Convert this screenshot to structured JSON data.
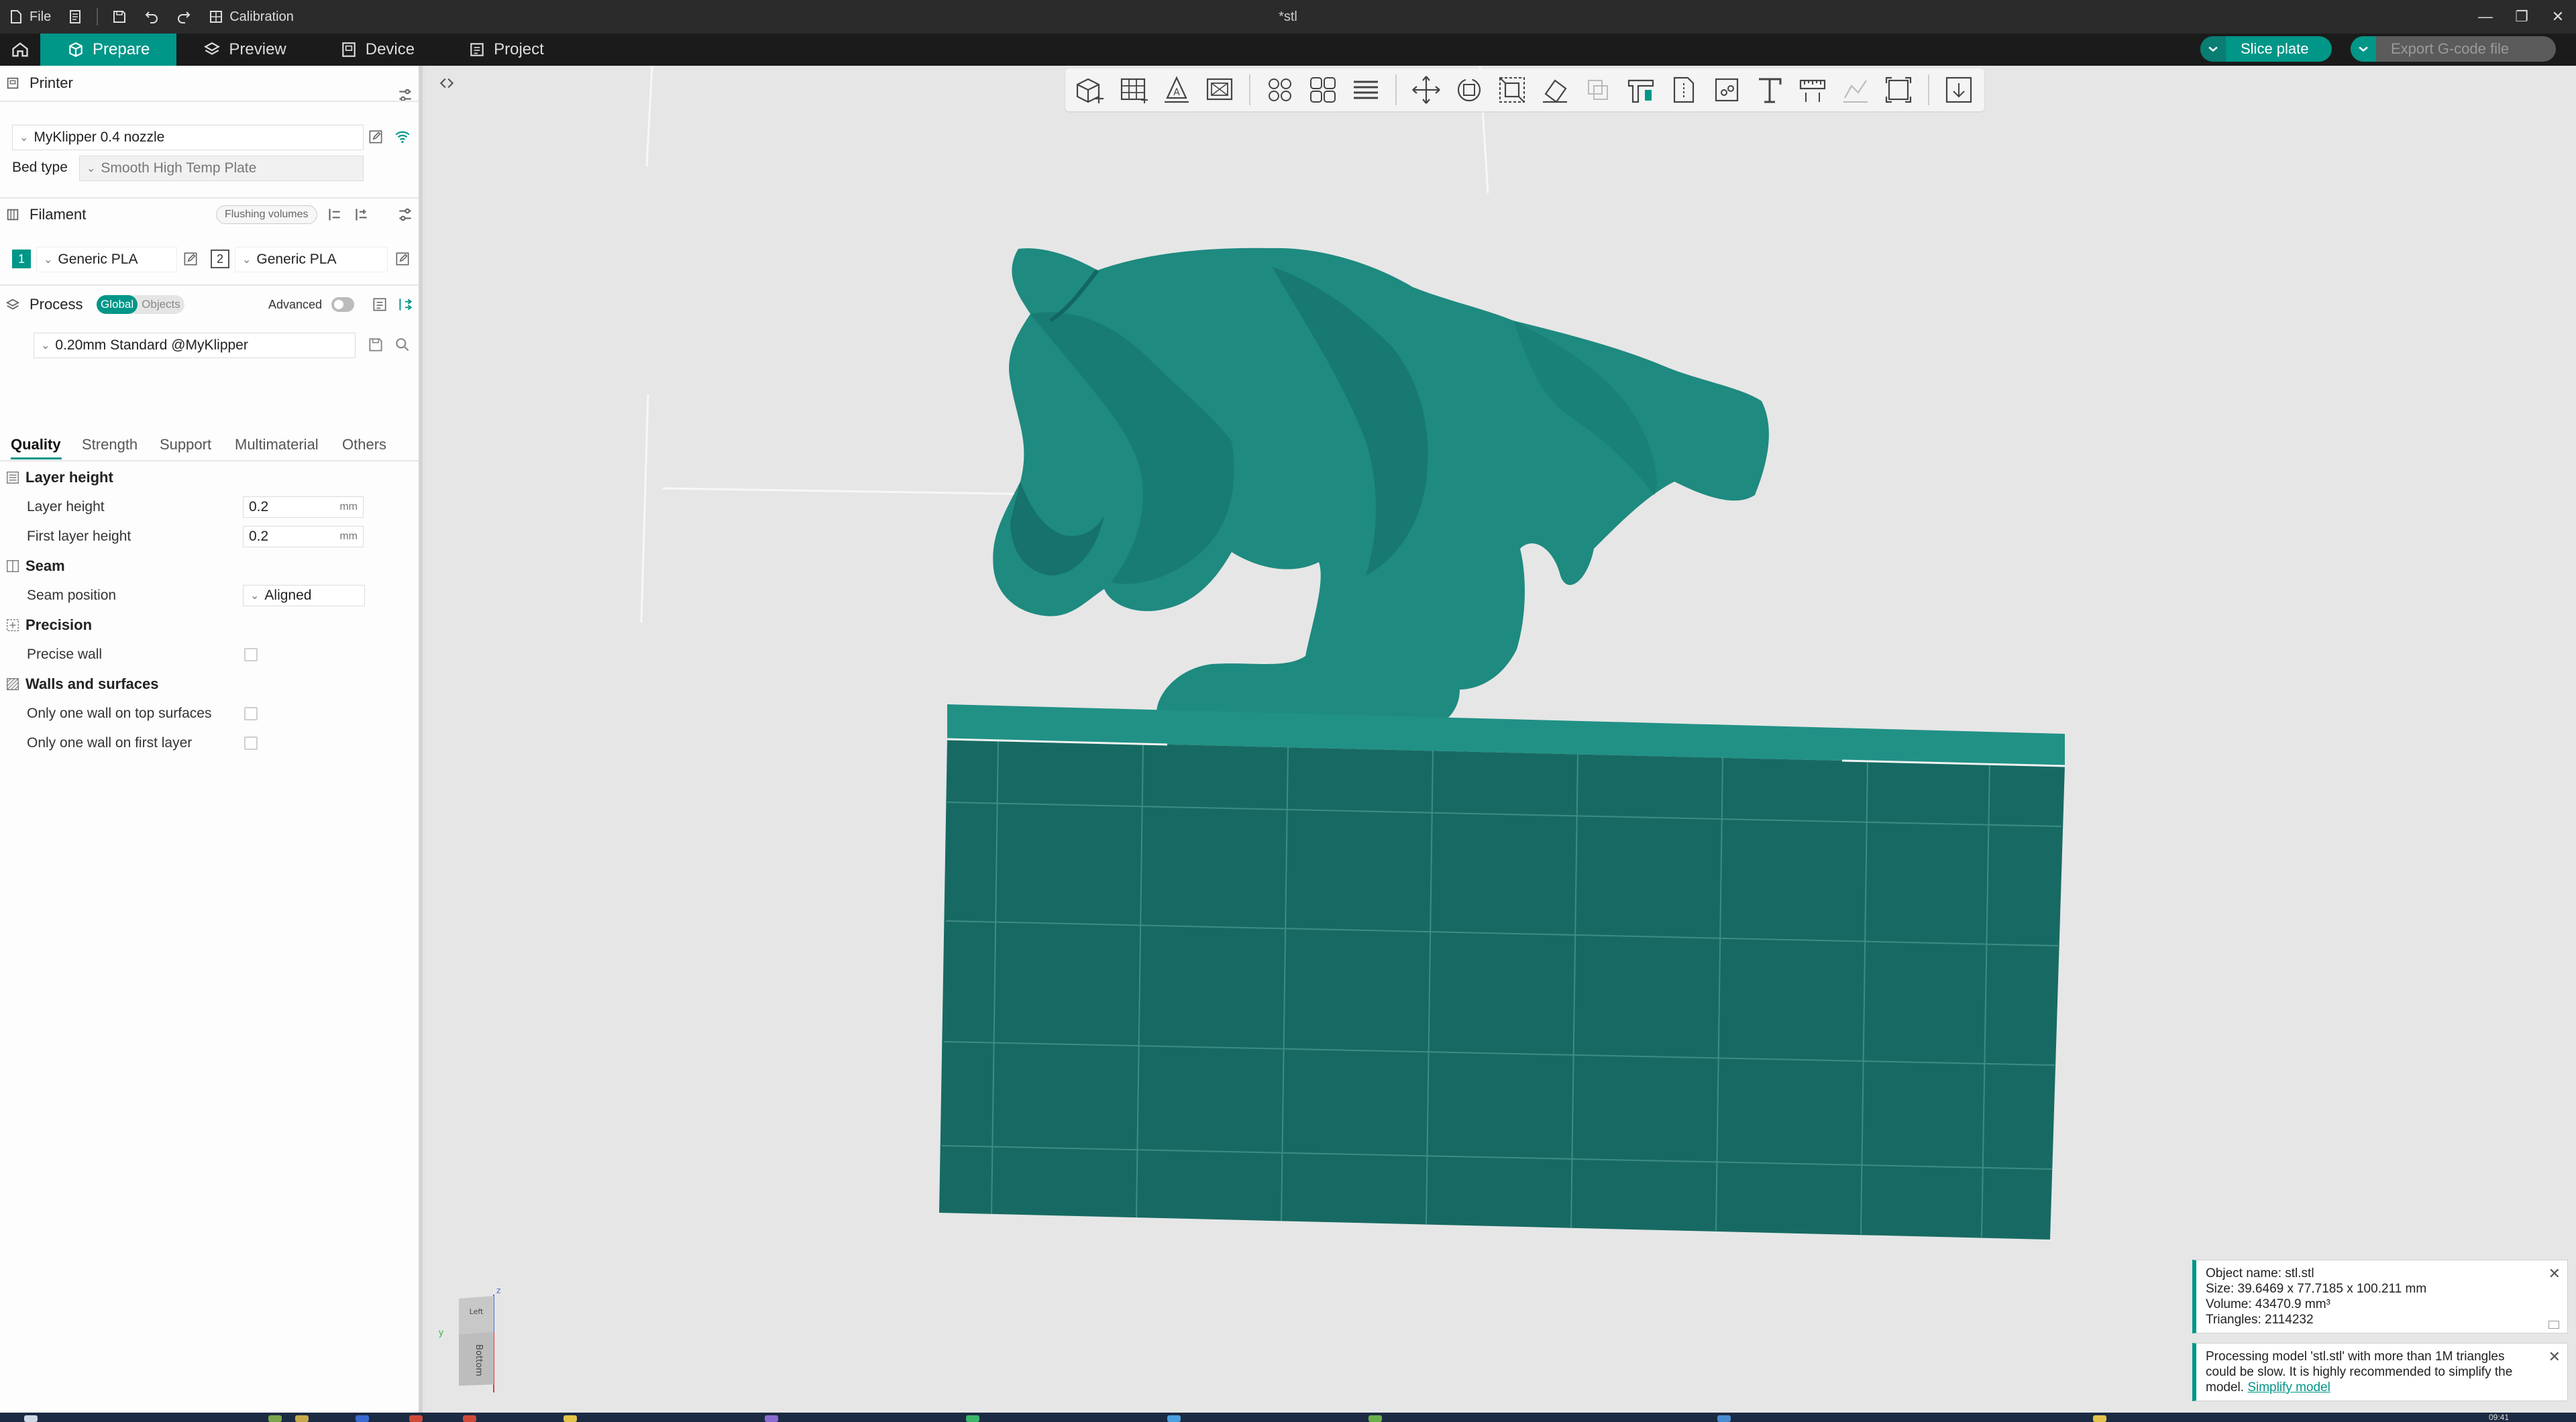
{
  "window": {
    "file_menu": "File",
    "calibration": "Calibration",
    "title": "*stl"
  },
  "tabs": {
    "prepare": "Prepare",
    "preview": "Preview",
    "device": "Device",
    "project": "Project",
    "slice_plate": "Slice plate",
    "export_gcode": "Export G-code file"
  },
  "printer": {
    "section": "Printer",
    "name": "MyKlipper 0.4 nozzle",
    "bed_type_label": "Bed type",
    "bed_type": "Smooth High Temp Plate"
  },
  "filament": {
    "section": "Filament",
    "flushing": "Flushing volumes",
    "slots": [
      {
        "index": "1",
        "name": "Generic PLA"
      },
      {
        "index": "2",
        "name": "Generic PLA"
      }
    ]
  },
  "process": {
    "section": "Process",
    "global": "Global",
    "objects": "Objects",
    "advanced": "Advanced",
    "preset": "0.20mm Standard @MyKlipper",
    "tabs": [
      "Quality",
      "Strength",
      "Support",
      "Multimaterial",
      "Others"
    ],
    "groups": {
      "layer_height": {
        "title": "Layer height",
        "layer_height_label": "Layer height",
        "layer_height_value": "0.2",
        "first_layer_label": "First layer height",
        "first_layer_value": "0.2",
        "unit": "mm"
      },
      "seam": {
        "title": "Seam",
        "position_label": "Seam position",
        "position_value": "Aligned"
      },
      "precision": {
        "title": "Precision",
        "precise_wall": "Precise wall"
      },
      "walls": {
        "title": "Walls and surfaces",
        "one_wall_top": "Only one wall on top surfaces",
        "one_wall_first": "Only one wall on first layer"
      }
    }
  },
  "navcube": {
    "face_top": "Left",
    "face_front": "Bottom",
    "axis_z": "z",
    "axis_y": "y"
  },
  "notices": {
    "object_info": {
      "name": "Object name: stl.stl",
      "size": "Size: 39.6469 x 77.7185 x 100.211 mm",
      "volume": "Volume: 43470.9 mm³",
      "triangles": "Triangles: 2114232"
    },
    "processing": {
      "text": "Processing model 'stl.stl' with more than 1M triangles could be slow. It is highly recommended to simplify the model.",
      "link": "Simplify model"
    }
  },
  "clock": "09:41",
  "colors": {
    "accent": "#009688",
    "model": "#1e8a80",
    "model_dark": "#176a63"
  }
}
